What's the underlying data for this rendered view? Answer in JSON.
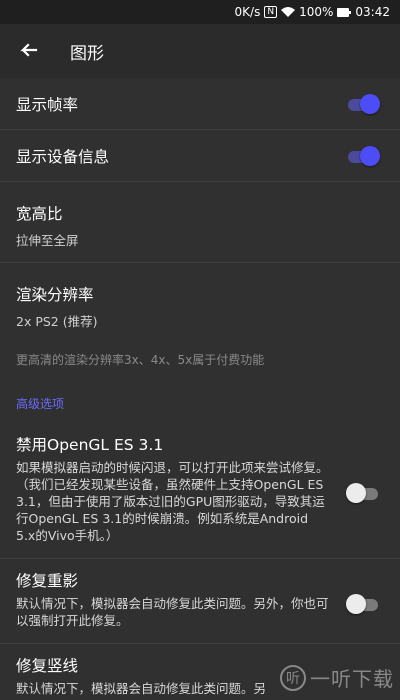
{
  "status_bar": {
    "net_speed": "0K/s",
    "nfc": "N",
    "battery_pct": "100%",
    "time": "03:42"
  },
  "app_bar": {
    "title": "图形"
  },
  "settings": {
    "show_fps": {
      "label": "显示帧率",
      "enabled": true
    },
    "show_device_info": {
      "label": "显示设备信息",
      "enabled": true
    },
    "aspect_ratio": {
      "label": "宽高比",
      "value": "拉伸至全屏"
    },
    "render_resolution": {
      "label": "渲染分辨率",
      "value": "2x PS2 (推荐)"
    },
    "resolution_note": "更高清的渲染分辨率3x、4x、5x属于付费功能",
    "advanced_header": "高级选项",
    "disable_opengl": {
      "label": "禁用OpenGL ES 3.1",
      "description": "如果模拟器启动的时候闪退，可以打开此项来尝试修复。（我们已经发现某些设备，虽然硬件上支持OpenGL ES 3.1，但由于使用了版本过旧的GPU图形驱动，导致其运行OpenGL ES 3.1的时候崩溃。例如系统是Android 5.x的Vivo手机。）",
      "enabled": false
    },
    "fix_shadow": {
      "label": "修复重影",
      "description": "默认情况下，模拟器会自动修复此类问题。另外，你也可以强制打开此修复。",
      "enabled": false
    },
    "fix_vertical_lines": {
      "label": "修复竖线",
      "description": "默认情况下，模拟器会自动修复此类问题。另"
    }
  },
  "watermark": {
    "logo_glyph": "听",
    "text": "一听下载"
  },
  "colors": {
    "accent": "#4d4df5",
    "section_header": "#6b6bff",
    "background": "#303030"
  }
}
